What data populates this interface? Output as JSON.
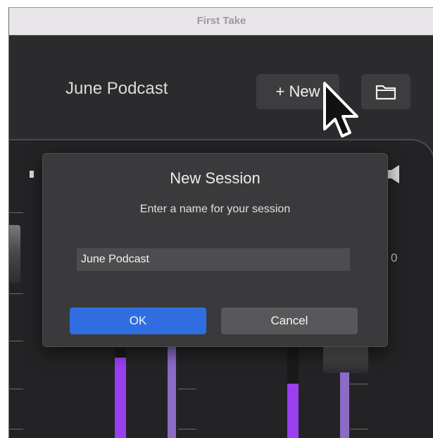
{
  "window": {
    "title": "First Take"
  },
  "header": {
    "session_name": "June Podcast",
    "new_button_label": "+ New"
  },
  "mixer": {
    "db_label": "0"
  },
  "dialog": {
    "title": "New Session",
    "message": "Enter a name for your session",
    "name_value": "June Podcast",
    "ok_label": "OK",
    "cancel_label": "Cancel"
  },
  "colors": {
    "accent": "#2f6de0",
    "meter_purple": "#9a3ff0",
    "meter_lavender": "#8b6bc6"
  },
  "icons": [
    "folder-icon",
    "speaker-left-icon",
    "speaker-right-icon",
    "mouse-cursor-icon"
  ]
}
